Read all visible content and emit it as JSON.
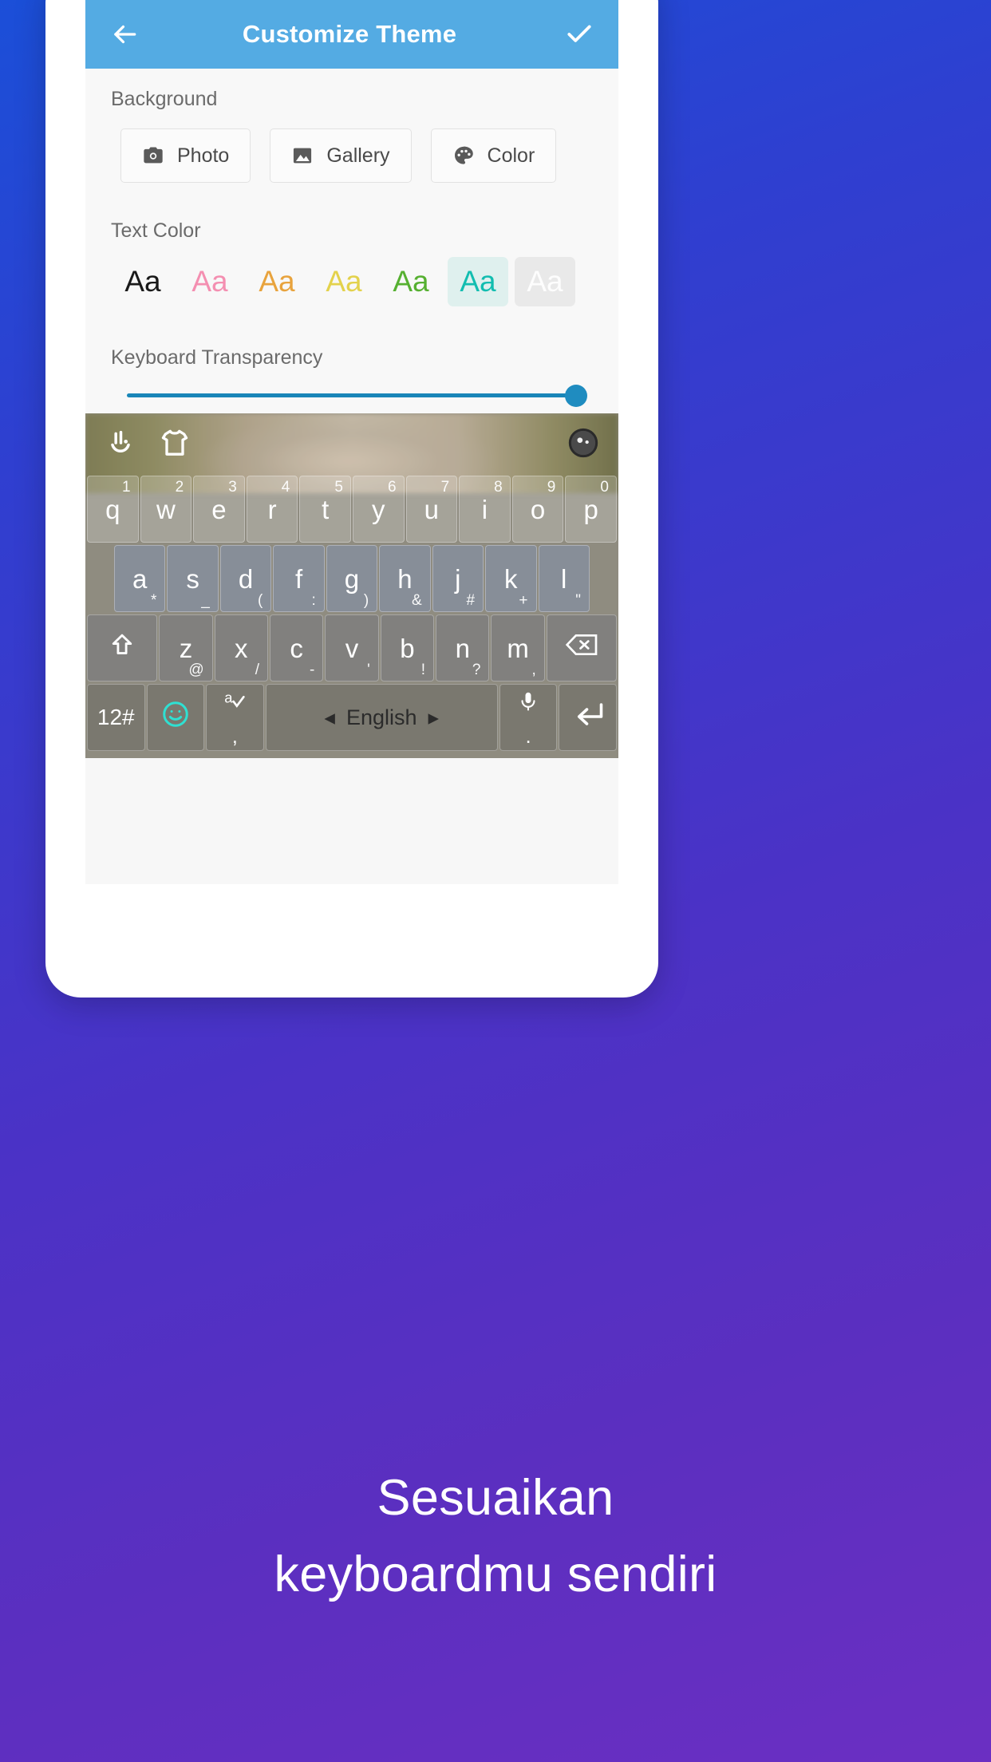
{
  "appbar": {
    "back_icon": "arrow-left-icon",
    "title": "Customize Theme",
    "confirm_icon": "check-icon",
    "background_color": "#54ABE3",
    "title_color": "#ffffff"
  },
  "background_section": {
    "label": "Background",
    "buttons": [
      {
        "label": "Photo",
        "icon": "camera-icon"
      },
      {
        "label": "Gallery",
        "icon": "image-icon"
      },
      {
        "label": "Color",
        "icon": "palette-icon"
      }
    ]
  },
  "text_color_section": {
    "label": "Text Color",
    "sample_text": "Aa",
    "swatches": [
      {
        "name": "black",
        "color": "#1a1a1a",
        "selected": false
      },
      {
        "name": "pink",
        "color": "#F48FB1",
        "selected": false
      },
      {
        "name": "orange",
        "color": "#E8A33D",
        "selected": false
      },
      {
        "name": "yellow",
        "color": "#E3D24C",
        "selected": false
      },
      {
        "name": "green",
        "color": "#56B031",
        "selected": false
      },
      {
        "name": "teal",
        "color": "#12BDB0",
        "selected": true,
        "selected_bg": "#dff0ee"
      },
      {
        "name": "white",
        "color": "#ffffff",
        "selected": false,
        "swatch_bg": "#e9e9e9"
      }
    ]
  },
  "transparency_section": {
    "label": "Keyboard Transparency",
    "value_percent": 100,
    "track_color": "#1986b8",
    "thumb_color": "#1f8cc0"
  },
  "keyboard": {
    "toolbar": [
      {
        "name": "gesture-typing-icon"
      },
      {
        "name": "theme-shirt-icon"
      },
      {
        "name": "settings-dial-icon"
      }
    ],
    "row1": [
      {
        "main": "q",
        "sup": "1"
      },
      {
        "main": "w",
        "sup": "2"
      },
      {
        "main": "e",
        "sup": "3"
      },
      {
        "main": "r",
        "sup": "4"
      },
      {
        "main": "t",
        "sup": "5"
      },
      {
        "main": "y",
        "sup": "6"
      },
      {
        "main": "u",
        "sup": "7"
      },
      {
        "main": "i",
        "sup": "8"
      },
      {
        "main": "o",
        "sup": "9"
      },
      {
        "main": "p",
        "sup": "0"
      }
    ],
    "row2": [
      {
        "main": "a",
        "sub": "*"
      },
      {
        "main": "s",
        "sub": "_"
      },
      {
        "main": "d",
        "sub": "("
      },
      {
        "main": "f",
        "sub": ":"
      },
      {
        "main": "g",
        "sub": ")"
      },
      {
        "main": "h",
        "sub": "&"
      },
      {
        "main": "j",
        "sub": "#"
      },
      {
        "main": "k",
        "sub": "+"
      },
      {
        "main": "l",
        "sub": "\""
      }
    ],
    "row3": [
      {
        "main": "shift-icon",
        "type": "icon"
      },
      {
        "main": "z",
        "sub": "@"
      },
      {
        "main": "x",
        "sub": "/"
      },
      {
        "main": "c",
        "sub": "-"
      },
      {
        "main": "v",
        "sub": "'"
      },
      {
        "main": "b",
        "sub": "!"
      },
      {
        "main": "n",
        "sub": "?"
      },
      {
        "main": "m",
        "sub": ","
      },
      {
        "main": "backspace-icon",
        "type": "icon"
      }
    ],
    "row4": [
      {
        "main": "12#",
        "type": "text"
      },
      {
        "main": "emoji-icon",
        "type": "icon"
      },
      {
        "main": "a",
        "sub": ",",
        "type": "autocorrect"
      },
      {
        "main": "English",
        "type": "space",
        "left_arrow": "◂",
        "right_arrow": "▸"
      },
      {
        "main": "mic-icon",
        "sub": ".",
        "type": "icon"
      },
      {
        "main": "enter-icon",
        "type": "icon"
      }
    ]
  },
  "caption": {
    "line1": "Sesuaikan",
    "line2": "keyboardmu sendiri",
    "color": "#ffffff"
  }
}
